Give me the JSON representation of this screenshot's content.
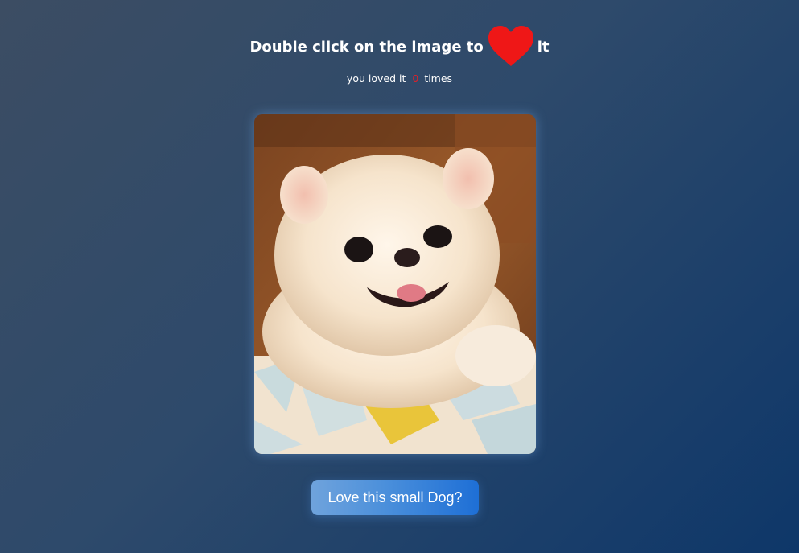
{
  "header": {
    "title_prefix": "Double click on the image to",
    "title_suffix": "it",
    "heart_icon": "heart-icon",
    "heart_color": "#ef1717"
  },
  "counter": {
    "prefix": "you loved it",
    "count": "0",
    "suffix": "times",
    "count_color": "#e0202a"
  },
  "photo": {
    "subject": "white pomeranian puppy"
  },
  "button": {
    "label": "Love this small Dog?"
  }
}
